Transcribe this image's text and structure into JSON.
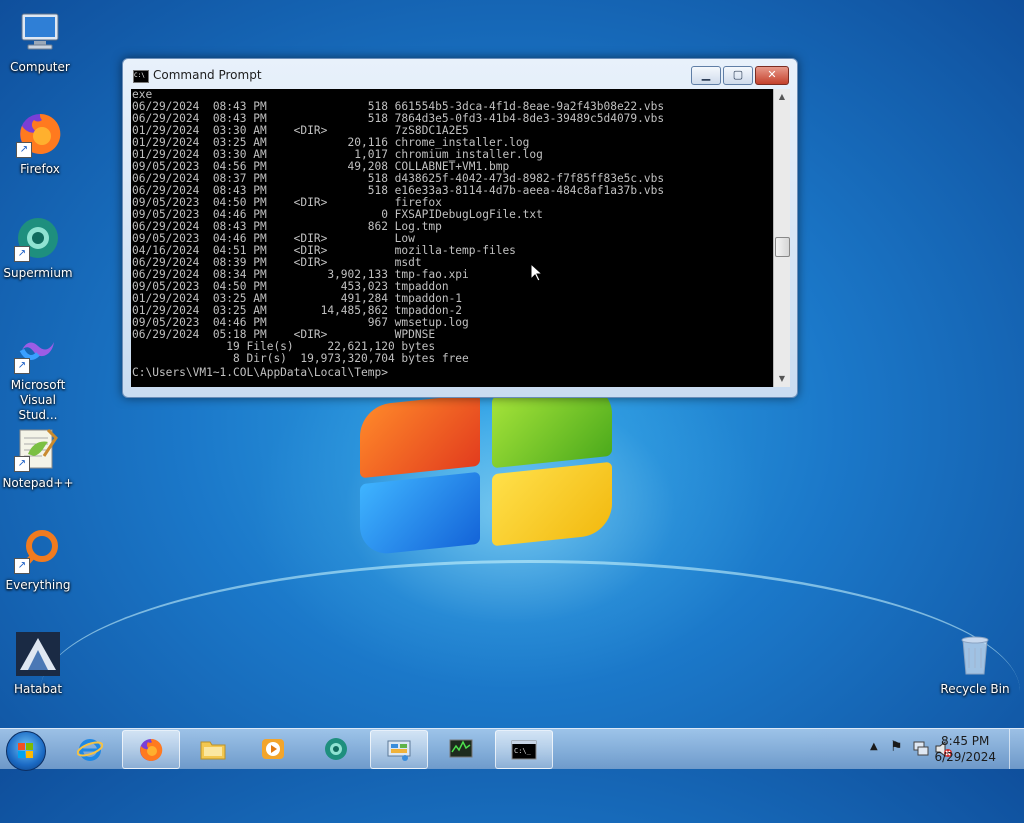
{
  "desktop": {
    "icons": [
      {
        "label": "Computer",
        "icon": "computer-icon"
      },
      {
        "label": "Firefox",
        "icon": "firefox-icon"
      },
      {
        "label": "Supermium",
        "icon": "supermium-icon"
      },
      {
        "label": "Microsoft Visual Stud...",
        "icon": "visual-studio-icon"
      },
      {
        "label": "Notepad++",
        "icon": "notepadpp-icon"
      },
      {
        "label": "Everything",
        "icon": "everything-icon"
      },
      {
        "label": "Hatabat",
        "icon": "hatabat-icon"
      },
      {
        "label": "Recycle Bin",
        "icon": "recycle-bin-icon"
      }
    ]
  },
  "window": {
    "title": "Command Prompt",
    "min_glyph": "▁",
    "max_glyph": "▢",
    "close_glyph": "✕",
    "console_lines": [
      "exe",
      "06/29/2024  08:43 PM               518 661554b5-3dca-4f1d-8eae-9a2f43b08e22.vbs",
      "06/29/2024  08:43 PM               518 7864d3e5-0fd3-41b4-8de3-39489c5d4079.vbs",
      "01/29/2024  03:30 AM    <DIR>          7zS8DC1A2E5",
      "01/29/2024  03:25 AM            20,116 chrome_installer.log",
      "01/29/2024  03:30 AM             1,017 chromium_installer.log",
      "09/05/2023  04:56 PM            49,208 COLLABNET+VM1.bmp",
      "06/29/2024  08:37 PM               518 d438625f-4042-473d-8982-f7f85ff83e5c.vbs",
      "06/29/2024  08:43 PM               518 e16e33a3-8114-4d7b-aeea-484c8af1a37b.vbs",
      "09/05/2023  04:50 PM    <DIR>          firefox",
      "09/05/2023  04:46 PM                 0 FXSAPIDebugLogFile.txt",
      "06/29/2024  08:43 PM               862 Log.tmp",
      "09/05/2023  04:46 PM    <DIR>          Low",
      "04/16/2024  04:51 PM    <DIR>          mozilla-temp-files",
      "06/29/2024  08:39 PM    <DIR>          msdt",
      "06/29/2024  08:34 PM         3,902,133 tmp-fao.xpi",
      "09/05/2023  04:50 PM           453,023 tmpaddon",
      "01/29/2024  03:25 AM           491,284 tmpaddon-1",
      "01/29/2024  03:25 AM        14,485,862 tmpaddon-2",
      "09/05/2023  04:46 PM               967 wmsetup.log",
      "06/29/2024  05:18 PM    <DIR>          WPDNSE",
      "              19 File(s)     22,621,120 bytes",
      "               8 Dir(s)  19,973,320,704 bytes free"
    ],
    "prompt": "C:\\Users\\VM1~1.COL\\AppData\\Local\\Temp>"
  },
  "taskbar": {
    "items": [
      {
        "name": "ie",
        "icon": "internet-explorer-icon",
        "active": false
      },
      {
        "name": "firefox",
        "icon": "firefox-icon",
        "active": true
      },
      {
        "name": "explorer",
        "icon": "folder-icon",
        "active": false
      },
      {
        "name": "media-player",
        "icon": "media-player-icon",
        "active": false
      },
      {
        "name": "supermium",
        "icon": "supermium-icon",
        "active": false
      },
      {
        "name": "control-panel",
        "icon": "control-panel-icon",
        "active": true
      },
      {
        "name": "task-manager",
        "icon": "task-manager-icon",
        "active": false
      },
      {
        "name": "command-prompt",
        "icon": "command-prompt-icon",
        "active": true
      }
    ],
    "clock_time": "8:45 PM",
    "clock_date": "6/29/2024"
  }
}
